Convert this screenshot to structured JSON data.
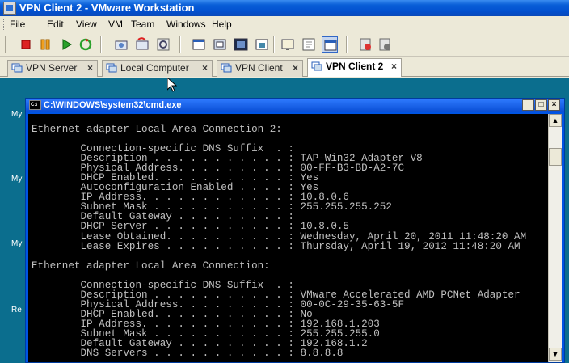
{
  "window": {
    "title": "VPN Client 2 - VMware Workstation"
  },
  "menu": [
    "File",
    "Edit",
    "View",
    "VM",
    "Team",
    "Windows",
    "Help"
  ],
  "tabs": [
    {
      "label": "VPN Server",
      "active": false
    },
    {
      "label": "Local Computer",
      "active": false
    },
    {
      "label": "VPN Client",
      "active": false
    },
    {
      "label": "VPN Client 2",
      "active": true
    }
  ],
  "desktop_labels": [
    "My",
    "My",
    "My",
    "Re"
  ],
  "cmd": {
    "title": "C:\\WINDOWS\\system32\\cmd.exe",
    "icon_label": "C:\\",
    "lines": [
      "Ethernet adapter Local Area Connection 2:",
      "",
      "        Connection-specific DNS Suffix  . :",
      "        Description . . . . . . . . . . . : TAP-Win32 Adapter V8",
      "        Physical Address. . . . . . . . . : 00-FF-B3-BD-A2-7C",
      "        DHCP Enabled. . . . . . . . . . . : Yes",
      "        Autoconfiguration Enabled . . . . : Yes",
      "        IP Address. . . . . . . . . . . . : 10.8.0.6",
      "        Subnet Mask . . . . . . . . . . . : 255.255.255.252",
      "        Default Gateway . . . . . . . . . :",
      "        DHCP Server . . . . . . . . . . . : 10.8.0.5",
      "        Lease Obtained. . . . . . . . . . : Wednesday, April 20, 2011 11:48:20 AM",
      "        Lease Expires . . . . . . . . . . : Thursday, April 19, 2012 11:48:20 AM",
      "",
      "Ethernet adapter Local Area Connection:",
      "",
      "        Connection-specific DNS Suffix  . :",
      "        Description . . . . . . . . . . . : VMware Accelerated AMD PCNet Adapter",
      "        Physical Address. . . . . . . . . : 00-0C-29-35-63-5F",
      "        DHCP Enabled. . . . . . . . . . . : No",
      "        IP Address. . . . . . . . . . . . : 192.168.1.203",
      "        Subnet Mask . . . . . . . . . . . : 255.255.255.0",
      "        Default Gateway . . . . . . . . . : 192.168.1.2",
      "        DNS Servers . . . . . . . . . . . : 8.8.8.8"
    ]
  },
  "toolbar_icons": [
    "stop-icon",
    "pause-icon",
    "play-icon",
    "reset-icon",
    "snapshot-icon",
    "revert-snapshot-icon",
    "snapshot-manager-icon",
    "normal-view-icon",
    "quick-switch-icon",
    "full-screen-icon",
    "unity-icon",
    "show-console-icon",
    "summary-view-icon",
    "appliance-view-icon",
    "preferences-icon",
    "settings-icon"
  ],
  "colors": {
    "title_bar": "#0a5fd8",
    "guest_desktop": "#0b6e8e",
    "console_bg": "#000000",
    "console_text": "#c0c0c0"
  }
}
